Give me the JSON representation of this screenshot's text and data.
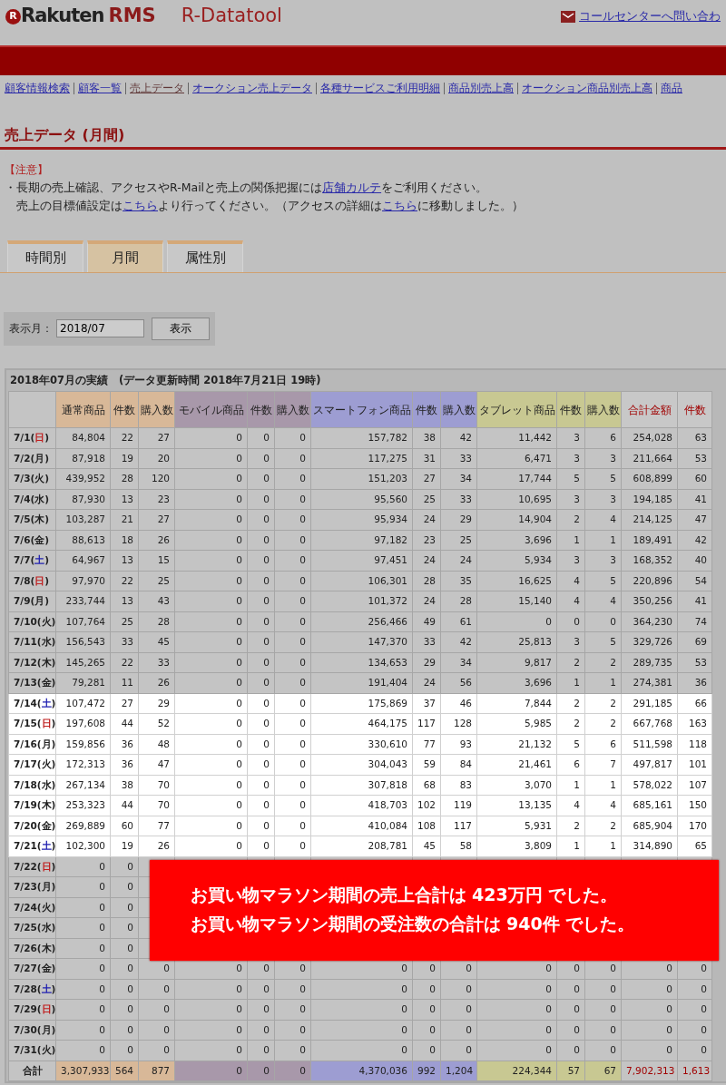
{
  "header": {
    "logo_mark": "R",
    "brand": "Rakuten",
    "brand_suffix": "RMS",
    "product": "R-Datatool",
    "contact_link": "コールセンターへ問い合わ"
  },
  "nav": [
    {
      "label": "顧客情報検索",
      "selected": false
    },
    {
      "label": "顧客一覧",
      "selected": false
    },
    {
      "label": "売上データ",
      "selected": true
    },
    {
      "label": "オークション売上データ",
      "selected": false
    },
    {
      "label": "各種サービスご利用明細",
      "selected": false
    },
    {
      "label": "商品別売上高",
      "selected": false
    },
    {
      "label": "オークション商品別売上高",
      "selected": false
    },
    {
      "label": "商品",
      "selected": false
    }
  ],
  "page_title": "売上データ (月間)",
  "notice": {
    "heading": "【注意】",
    "bullet": "・",
    "lines": [
      [
        {
          "text": "長期の売上確認、アクセスやR-Mailと売上の関係把握には"
        },
        {
          "link": "店舗カルテ"
        },
        {
          "text": "をご利用ください。"
        }
      ],
      [
        {
          "text": "売上の目標値設定は"
        },
        {
          "link": "こちら"
        },
        {
          "text": "より行ってください。（アクセスの詳細は"
        },
        {
          "link": "こちら"
        },
        {
          "text": "に移動しました。）"
        }
      ]
    ]
  },
  "tabs": [
    {
      "label": "時間別",
      "selected": false
    },
    {
      "label": "月間",
      "selected": true
    },
    {
      "label": "属性別",
      "selected": false
    }
  ],
  "month_form": {
    "label": "表示月：",
    "value": "2018/07",
    "button": "表示"
  },
  "table": {
    "caption": "2018年07月の実績　(データ更新時間 2018年7月21日 19時)",
    "columns": [
      {
        "label": "通常商品",
        "kind": "product",
        "color": "#d8b898"
      },
      {
        "label": "件数",
        "kind": "product",
        "color": "#d8b898"
      },
      {
        "label": "購入数",
        "kind": "product",
        "color": "#d8b898"
      },
      {
        "label": "モバイル商品",
        "kind": "product",
        "color": "#a898aa"
      },
      {
        "label": "件数",
        "kind": "product",
        "color": "#a898aa"
      },
      {
        "label": "購入数",
        "kind": "product",
        "color": "#a898aa"
      },
      {
        "label": "スマートフォン商品",
        "kind": "product",
        "color": "#9d9dd2"
      },
      {
        "label": "件数",
        "kind": "product",
        "color": "#9d9dd2"
      },
      {
        "label": "購入数",
        "kind": "product",
        "color": "#9d9dd2"
      },
      {
        "label": "タブレット商品",
        "kind": "product",
        "color": "#c8c892"
      },
      {
        "label": "件数",
        "kind": "product",
        "color": "#c8c892"
      },
      {
        "label": "購入数",
        "kind": "product",
        "color": "#c8c892"
      },
      {
        "label": "合計金額",
        "kind": "total",
        "color": "#c8c8c8"
      },
      {
        "label": "件数",
        "kind": "total",
        "color": "#c8c8c8"
      }
    ],
    "rows": [
      {
        "date": "7/1(",
        "weekday": {
          "text": "日",
          "color": "#c02020"
        },
        "close": ")",
        "highlighted": false,
        "cells": [
          "84,804",
          "22",
          "27",
          "0",
          "0",
          "0",
          "157,782",
          "38",
          "42",
          "11,442",
          "3",
          "6",
          "254,028",
          "63"
        ]
      },
      {
        "date": "7/2(",
        "weekday": {
          "text": "月",
          "color": "#222222"
        },
        "close": ")",
        "highlighted": false,
        "cells": [
          "87,918",
          "19",
          "20",
          "0",
          "0",
          "0",
          "117,275",
          "31",
          "33",
          "6,471",
          "3",
          "3",
          "211,664",
          "53"
        ]
      },
      {
        "date": "7/3(",
        "weekday": {
          "text": "火",
          "color": "#222222"
        },
        "close": ")",
        "highlighted": false,
        "cells": [
          "439,952",
          "28",
          "120",
          "0",
          "0",
          "0",
          "151,203",
          "27",
          "34",
          "17,744",
          "5",
          "5",
          "608,899",
          "60"
        ]
      },
      {
        "date": "7/4(",
        "weekday": {
          "text": "水",
          "color": "#222222"
        },
        "close": ")",
        "highlighted": false,
        "cells": [
          "87,930",
          "13",
          "23",
          "0",
          "0",
          "0",
          "95,560",
          "25",
          "33",
          "10,695",
          "3",
          "3",
          "194,185",
          "41"
        ]
      },
      {
        "date": "7/5(",
        "weekday": {
          "text": "木",
          "color": "#222222"
        },
        "close": ")",
        "highlighted": false,
        "cells": [
          "103,287",
          "21",
          "27",
          "0",
          "0",
          "0",
          "95,934",
          "24",
          "29",
          "14,904",
          "2",
          "4",
          "214,125",
          "47"
        ]
      },
      {
        "date": "7/6(",
        "weekday": {
          "text": "金",
          "color": "#222222"
        },
        "close": ")",
        "highlighted": false,
        "cells": [
          "88,613",
          "18",
          "26",
          "0",
          "0",
          "0",
          "97,182",
          "23",
          "25",
          "3,696",
          "1",
          "1",
          "189,491",
          "42"
        ]
      },
      {
        "date": "7/7(",
        "weekday": {
          "text": "土",
          "color": "#2020b0"
        },
        "close": ")",
        "highlighted": false,
        "cells": [
          "64,967",
          "13",
          "15",
          "0",
          "0",
          "0",
          "97,451",
          "24",
          "24",
          "5,934",
          "3",
          "3",
          "168,352",
          "40"
        ]
      },
      {
        "date": "7/8(",
        "weekday": {
          "text": "日",
          "color": "#c02020"
        },
        "close": ")",
        "highlighted": false,
        "cells": [
          "97,970",
          "22",
          "25",
          "0",
          "0",
          "0",
          "106,301",
          "28",
          "35",
          "16,625",
          "4",
          "5",
          "220,896",
          "54"
        ]
      },
      {
        "date": "7/9(",
        "weekday": {
          "text": "月",
          "color": "#222222"
        },
        "close": ")",
        "highlighted": false,
        "cells": [
          "233,744",
          "13",
          "43",
          "0",
          "0",
          "0",
          "101,372",
          "24",
          "28",
          "15,140",
          "4",
          "4",
          "350,256",
          "41"
        ]
      },
      {
        "date": "7/10(",
        "weekday": {
          "text": "火",
          "color": "#222222"
        },
        "close": ")",
        "highlighted": false,
        "cells": [
          "107,764",
          "25",
          "28",
          "0",
          "0",
          "0",
          "256,466",
          "49",
          "61",
          "0",
          "0",
          "0",
          "364,230",
          "74"
        ]
      },
      {
        "date": "7/11(",
        "weekday": {
          "text": "水",
          "color": "#222222"
        },
        "close": ")",
        "highlighted": false,
        "cells": [
          "156,543",
          "33",
          "45",
          "0",
          "0",
          "0",
          "147,370",
          "33",
          "42",
          "25,813",
          "3",
          "5",
          "329,726",
          "69"
        ]
      },
      {
        "date": "7/12(",
        "weekday": {
          "text": "木",
          "color": "#222222"
        },
        "close": ")",
        "highlighted": false,
        "cells": [
          "145,265",
          "22",
          "33",
          "0",
          "0",
          "0",
          "134,653",
          "29",
          "34",
          "9,817",
          "2",
          "2",
          "289,735",
          "53"
        ]
      },
      {
        "date": "7/13(",
        "weekday": {
          "text": "金",
          "color": "#222222"
        },
        "close": ")",
        "highlighted": false,
        "cells": [
          "79,281",
          "11",
          "26",
          "0",
          "0",
          "0",
          "191,404",
          "24",
          "56",
          "3,696",
          "1",
          "1",
          "274,381",
          "36"
        ]
      },
      {
        "date": "7/14(",
        "weekday": {
          "text": "土",
          "color": "#2020b0"
        },
        "close": ")",
        "highlighted": true,
        "cells": [
          "107,472",
          "27",
          "29",
          "0",
          "0",
          "0",
          "175,869",
          "37",
          "46",
          "7,844",
          "2",
          "2",
          "291,185",
          "66"
        ]
      },
      {
        "date": "7/15(",
        "weekday": {
          "text": "日",
          "color": "#c02020"
        },
        "close": ")",
        "highlighted": true,
        "cells": [
          "197,608",
          "44",
          "52",
          "0",
          "0",
          "0",
          "464,175",
          "117",
          "128",
          "5,985",
          "2",
          "2",
          "667,768",
          "163"
        ]
      },
      {
        "date": "7/16(",
        "weekday": {
          "text": "月",
          "color": "#222222"
        },
        "close": ")",
        "highlighted": true,
        "cells": [
          "159,856",
          "36",
          "48",
          "0",
          "0",
          "0",
          "330,610",
          "77",
          "93",
          "21,132",
          "5",
          "6",
          "511,598",
          "118"
        ]
      },
      {
        "date": "7/17(",
        "weekday": {
          "text": "火",
          "color": "#222222"
        },
        "close": ")",
        "highlighted": true,
        "cells": [
          "172,313",
          "36",
          "47",
          "0",
          "0",
          "0",
          "304,043",
          "59",
          "84",
          "21,461",
          "6",
          "7",
          "497,817",
          "101"
        ]
      },
      {
        "date": "7/18(",
        "weekday": {
          "text": "水",
          "color": "#222222"
        },
        "close": ")",
        "highlighted": true,
        "cells": [
          "267,134",
          "38",
          "70",
          "0",
          "0",
          "0",
          "307,818",
          "68",
          "83",
          "3,070",
          "1",
          "1",
          "578,022",
          "107"
        ]
      },
      {
        "date": "7/19(",
        "weekday": {
          "text": "木",
          "color": "#222222"
        },
        "close": ")",
        "highlighted": true,
        "cells": [
          "253,323",
          "44",
          "70",
          "0",
          "0",
          "0",
          "418,703",
          "102",
          "119",
          "13,135",
          "4",
          "4",
          "685,161",
          "150"
        ]
      },
      {
        "date": "7/20(",
        "weekday": {
          "text": "金",
          "color": "#222222"
        },
        "close": ")",
        "highlighted": true,
        "cells": [
          "269,889",
          "60",
          "77",
          "0",
          "0",
          "0",
          "410,084",
          "108",
          "117",
          "5,931",
          "2",
          "2",
          "685,904",
          "170"
        ]
      },
      {
        "date": "7/21(",
        "weekday": {
          "text": "土",
          "color": "#2020b0"
        },
        "close": ")",
        "highlighted": true,
        "cells": [
          "102,300",
          "19",
          "26",
          "0",
          "0",
          "0",
          "208,781",
          "45",
          "58",
          "3,809",
          "1",
          "1",
          "314,890",
          "65"
        ]
      },
      {
        "date": "7/22(",
        "weekday": {
          "text": "日",
          "color": "#c02020"
        },
        "close": ")",
        "highlighted": false,
        "cells": [
          "0",
          "0"
        ]
      },
      {
        "date": "7/23(",
        "weekday": {
          "text": "月",
          "color": "#222222"
        },
        "close": ")",
        "highlighted": false,
        "cells": [
          "0",
          "0"
        ]
      },
      {
        "date": "7/24(",
        "weekday": {
          "text": "火",
          "color": "#222222"
        },
        "close": ")",
        "highlighted": false,
        "cells": [
          "0",
          "0"
        ]
      },
      {
        "date": "7/25(",
        "weekday": {
          "text": "水",
          "color": "#222222"
        },
        "close": ")",
        "highlighted": false,
        "cells": [
          "0",
          "0"
        ]
      },
      {
        "date": "7/26(",
        "weekday": {
          "text": "木",
          "color": "#222222"
        },
        "close": ")",
        "highlighted": false,
        "cells": [
          "0",
          "0"
        ]
      },
      {
        "date": "7/27(",
        "weekday": {
          "text": "金",
          "color": "#222222"
        },
        "close": ")",
        "highlighted": false,
        "cells": [
          "0",
          "0",
          "0",
          "0",
          "0",
          "0",
          "0",
          "0",
          "0",
          "0",
          "0",
          "0",
          "0",
          "0"
        ]
      },
      {
        "date": "7/28(",
        "weekday": {
          "text": "土",
          "color": "#2020b0"
        },
        "close": ")",
        "highlighted": false,
        "cells": [
          "0",
          "0",
          "0",
          "0",
          "0",
          "0",
          "0",
          "0",
          "0",
          "0",
          "0",
          "0",
          "0",
          "0"
        ]
      },
      {
        "date": "7/29(",
        "weekday": {
          "text": "日",
          "color": "#c02020"
        },
        "close": ")",
        "highlighted": false,
        "cells": [
          "0",
          "0",
          "0",
          "0",
          "0",
          "0",
          "0",
          "0",
          "0",
          "0",
          "0",
          "0",
          "0",
          "0"
        ]
      },
      {
        "date": "7/30(",
        "weekday": {
          "text": "月",
          "color": "#222222"
        },
        "close": ")",
        "highlighted": false,
        "cells": [
          "0",
          "0",
          "0",
          "0",
          "0",
          "0",
          "0",
          "0",
          "0",
          "0",
          "0",
          "0",
          "0",
          "0"
        ]
      },
      {
        "date": "7/31(",
        "weekday": {
          "text": "火",
          "color": "#222222"
        },
        "close": ")",
        "highlighted": false,
        "cells": [
          "0",
          "0",
          "0",
          "0",
          "0",
          "0",
          "0",
          "0",
          "0",
          "0",
          "0",
          "0",
          "0",
          "0"
        ]
      }
    ],
    "total": {
      "label": "合計",
      "cells": [
        "3,307,933",
        "564",
        "877",
        "0",
        "0",
        "0",
        "4,370,036",
        "992",
        "1,204",
        "224,344",
        "57",
        "67",
        "7,902,313",
        "1,613"
      ]
    }
  },
  "callout": {
    "lines": [
      "お買い物マラソン期間の売上合計は 423万円 でした。",
      "お買い物マラソン期間の受注数の合計は 940件 でした。"
    ]
  }
}
